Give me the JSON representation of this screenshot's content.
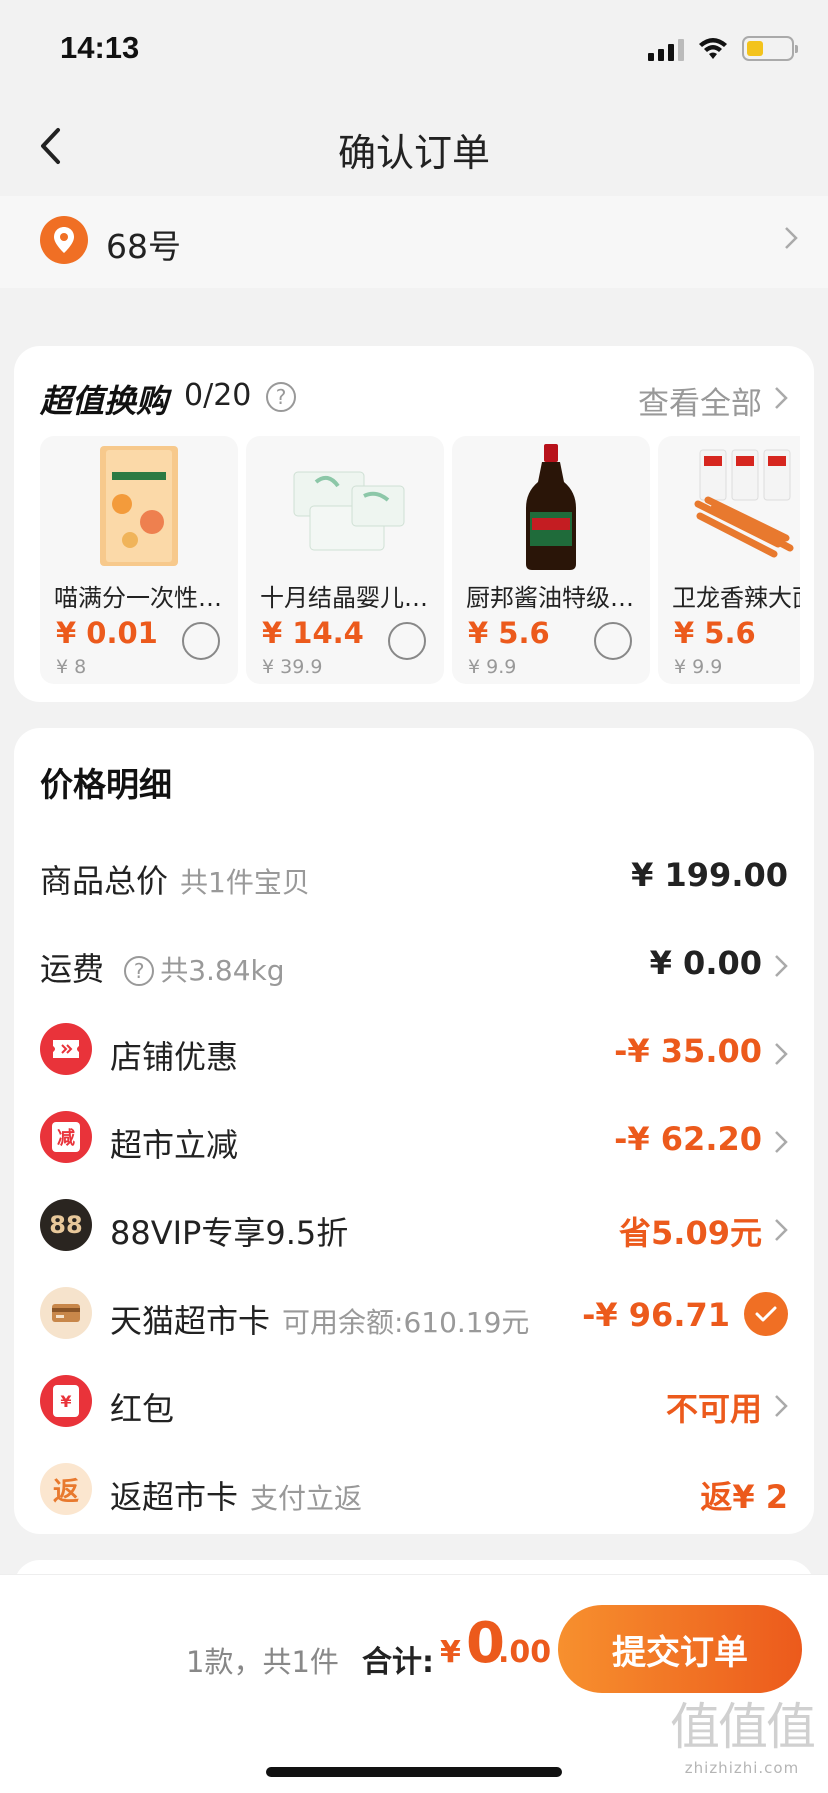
{
  "status_bar": {
    "time": "14:13"
  },
  "nav": {
    "title": "确认订单"
  },
  "address": {
    "text": "68号"
  },
  "deals": {
    "title": "超值换购",
    "count": "0/20",
    "view_all": "查看全部",
    "items": [
      {
        "name": "喵满分一次性洗脸巾",
        "price": "¥ 0.01",
        "original": "¥ 8"
      },
      {
        "name": "十月结晶婴儿纸巾",
        "price": "¥ 14.4",
        "original": "¥ 39.9"
      },
      {
        "name": "厨邦酱油特级生抽",
        "price": "¥ 5.6",
        "original": "¥ 9.9"
      },
      {
        "name": "卫龙香辣大面筋",
        "price": "¥ 5.6",
        "original": "¥ 9.9"
      }
    ]
  },
  "price_detail": {
    "title": "价格明细",
    "goods_total": {
      "label": "商品总价",
      "sub": "共1件宝贝",
      "value": "¥ 199.00"
    },
    "shipping": {
      "label": "运费",
      "sub": "共3.84kg",
      "value": "¥ 0.00"
    },
    "shop_discount": {
      "label": "店铺优惠",
      "value": "-¥ 35.00"
    },
    "market_discount": {
      "label": "超市立减",
      "icon_text": "减",
      "value": "-¥ 62.20"
    },
    "vip": {
      "label": "88VIP专享9.5折",
      "icon_text": "88",
      "value": "省5.09元"
    },
    "market_card": {
      "label": "天猫超市卡",
      "sub": "可用余额:610.19元",
      "value": "-¥ 96.71"
    },
    "red_packet": {
      "label": "红包",
      "icon_text": "¥",
      "value": "不可用"
    },
    "cashback": {
      "label": "返超市卡",
      "sub": "支付立返",
      "icon_text": "返",
      "value": "返¥ 2"
    }
  },
  "bottom": {
    "count_text": "1款，共1件",
    "total_label": "合计:",
    "currency": "¥",
    "total_int": "0",
    "total_dec": ".00",
    "submit": "提交订单"
  },
  "watermark": {
    "logo": "值值值",
    "url": "zhizhizhi.com"
  },
  "colors": {
    "accent": "#ec5a1c",
    "accent_light": "#f7902e",
    "muted": "#999999"
  }
}
